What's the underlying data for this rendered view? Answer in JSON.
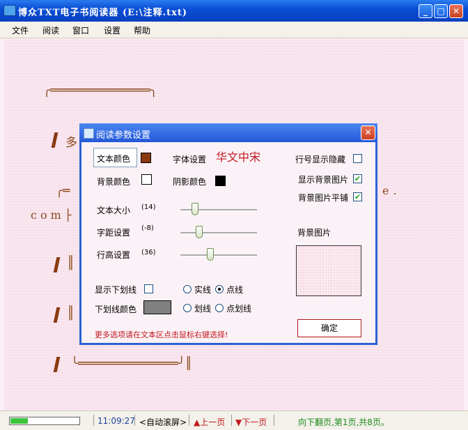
{
  "window": {
    "title": "博众TXT电子书阅读器 (E:\\注释.txt)"
  },
  "menu": [
    "文件",
    "阅读",
    "窗口",
    "设置",
    "帮助"
  ],
  "book": {
    "line1": "╭══════════════╮",
    "line2": "多",
    "line3a": "╭═",
    "line3b": "e.",
    "line4": "com├",
    "line5": "║",
    "line6": "║",
    "line7": "╰══════════════╯║"
  },
  "dialog": {
    "title": "阅读参数设置",
    "text_color_label": "文本颜色",
    "text_color": "#8b3a10",
    "font_label": "字体设置",
    "font_name": "华文中宋",
    "line_number_label": "行号显示隐藏",
    "line_number_checked": false,
    "bg_color_label": "背景颜色",
    "bg_color": "#ffffff",
    "shadow_color_label": "阴影颜色",
    "shadow_color": "#000000",
    "show_bg_image_label": "显示背景图片",
    "show_bg_image_checked": true,
    "tile_bg_label": "背景图片平铺",
    "tile_bg_checked": true,
    "font_size_label": "文本大小",
    "font_size_value": "(14)",
    "char_spacing_label": "字距设置",
    "char_spacing_value": "(-8)",
    "line_height_label": "行高设置",
    "line_height_value": "(36)",
    "bg_image_label": "背景图片",
    "underline_label": "显示下划线",
    "underline_checked": false,
    "solid_label": "实线",
    "dotted_label": "点线",
    "underline_color_label": "下划线颜色",
    "underline_color": "#808080",
    "dash_label": "划线",
    "dashdot_label": "点划线",
    "hint": "更多选项请在文本区点击鼠标右键选择!",
    "ok_label": "确定"
  },
  "status": {
    "progress": 0.25,
    "time": "11:09:27",
    "auto_scroll": "<自动滚屏>",
    "prev_page": "▲上一页",
    "next_page": "▼下一页",
    "page_info": "向下翻页,第1页,共8页。"
  },
  "colors": {
    "accent": "#0a4fd6",
    "book_text": "#8a4a1a",
    "hint": "#c0181c",
    "font_name": "#c0181c"
  }
}
